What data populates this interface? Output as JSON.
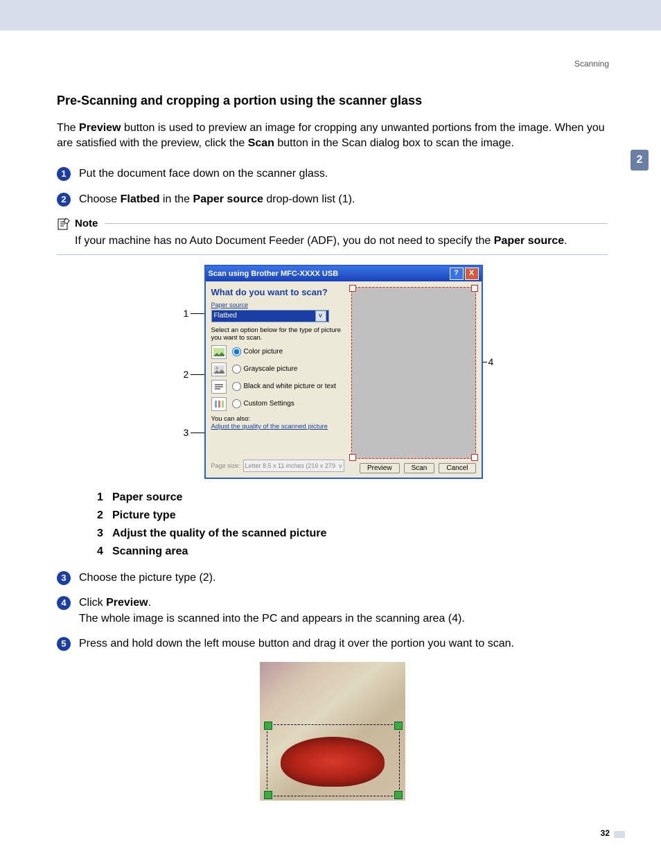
{
  "header": {
    "section_name": "Scanning"
  },
  "side_tab": "2",
  "page_number": "32",
  "title": "Pre-Scanning and cropping a portion using the scanner glass",
  "intro": {
    "p1_a": "The ",
    "p1_b_bold": "Preview",
    "p1_c": " button is used to preview an image for cropping any unwanted portions from the image. When you are satisfied with the preview, click the ",
    "p1_d_bold": "Scan",
    "p1_e": " button in the Scan dialog box to scan the image."
  },
  "steps": {
    "s1": {
      "n": "1",
      "text": "Put the document face down on the scanner glass."
    },
    "s2": {
      "n": "2",
      "a": "Choose ",
      "b_bold": "Flatbed",
      "c": " in the ",
      "d_bold": "Paper source",
      "e": " drop-down list (1)."
    },
    "s3": {
      "n": "3",
      "text": "Choose the picture type (2)."
    },
    "s4": {
      "n": "4",
      "a": "Click ",
      "b_bold": "Preview",
      "c": ".",
      "line2": "The whole image is scanned into the PC and appears in the scanning area (4)."
    },
    "s5": {
      "n": "5",
      "text": "Press and hold down the left mouse button and drag it over the portion you want to scan."
    }
  },
  "note": {
    "label": "Note",
    "a": "If your machine has no Auto Document Feeder (ADF), you do not need to specify the ",
    "b_bold": "Paper source",
    "c": "."
  },
  "dialog": {
    "title": "Scan using Brother MFC-XXXX USB",
    "question": "What do you want to scan?",
    "paper_source_label": "Paper source",
    "paper_source_value": "Flatbed",
    "select_prompt": "Select an option below for the type of picture you want to scan.",
    "opts": {
      "color": "Color picture",
      "grayscale": "Grayscale picture",
      "bw": "Black and white picture or text",
      "custom": "Custom Settings"
    },
    "youcan": "You can also:",
    "adjust_link": "Adjust the quality of the scanned picture",
    "page_size_label": "Page size:",
    "page_size_value": "Letter 8.5 x 11 inches (216 x 279",
    "buttons": {
      "preview": "Preview",
      "scan": "Scan",
      "cancel": "Cancel"
    }
  },
  "callouts": {
    "c1": "1",
    "c2": "2",
    "c3": "3",
    "c4": "4"
  },
  "legend": {
    "l1": {
      "n": "1",
      "t": "Paper source"
    },
    "l2": {
      "n": "2",
      "t": "Picture type"
    },
    "l3": {
      "n": "3",
      "t": "Adjust the quality of the scanned picture"
    },
    "l4": {
      "n": "4",
      "t": "Scanning area"
    }
  }
}
